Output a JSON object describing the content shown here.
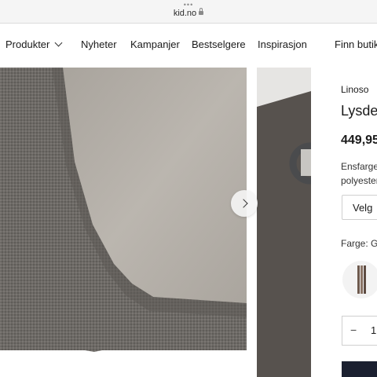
{
  "browser": {
    "dots": "•••",
    "url": "kid.no"
  },
  "nav": {
    "items": [
      {
        "label": "Produkter",
        "has_dropdown": true
      },
      {
        "label": "Nyheter"
      },
      {
        "label": "Kampanjer"
      },
      {
        "label": "Bestselgere"
      },
      {
        "label": "Inspirasjon"
      },
      {
        "label": "Finn butikk"
      }
    ]
  },
  "product": {
    "brand": "Linoso",
    "title": "Lysdempende gardin",
    "price": "449,95",
    "description_line1": "Ensfarget",
    "description_line2": "polyester",
    "select_label": "Velg",
    "color_label": "Farge: G",
    "quantity": "1"
  },
  "colors": {
    "fabric": "#6b6864",
    "lining": "#b7b2ab",
    "buy_button": "#1b2030"
  },
  "icons": {
    "lock": "lock-icon",
    "dropdown": "chevron-down-icon",
    "next": "chevron-right-icon",
    "minus": "minus-icon"
  }
}
